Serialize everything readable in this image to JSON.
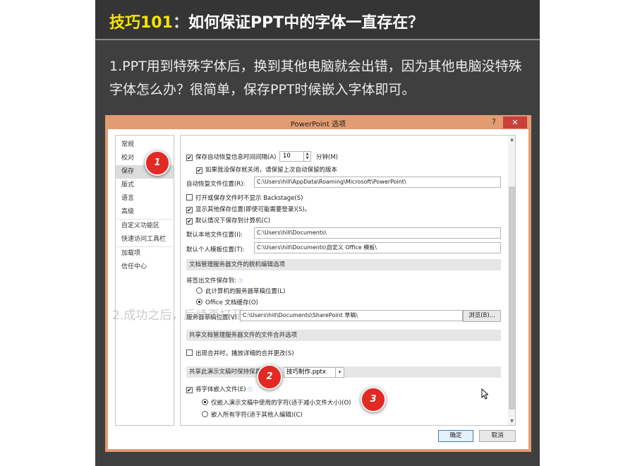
{
  "header": {
    "title_prefix": "技巧101",
    "title_text": "：如何保证PPT中的字体一直存在？"
  },
  "intro": "1.PPT用到特殊字体后，换到其他电脑就会出错，因为其他电脑没特殊字体怎么办？很简单，保存PPT时候嵌入字体即可。",
  "dialog": {
    "title": "PowerPoint 选项",
    "help": "?",
    "close": "✕",
    "nav": [
      "常规",
      "校对",
      "保存",
      "版式",
      "语言",
      "高级",
      "自定义功能区",
      "快速访问工具栏",
      "加载项",
      "信任中心"
    ],
    "content": {
      "autorecover_label": "保存自动恢复信息时间间隔(A)",
      "autorecover_minutes": "10",
      "minutes_unit": "分钟(M)",
      "keep_last_label": "如果我没保存就关闭，请保留上次自动保留的版本",
      "autorecover_location_label": "自动恢复文件位置(R):",
      "autorecover_location_value": "C:\\Users\\hill\\AppData\\Roaming\\Microsoft\\PowerPoint\\",
      "no_backstage_label": "打开或保存文件时不显示 Backstage(S)",
      "show_additional_label": "显示其他保存位置(即使可能需要登录)(S)。",
      "default_local_label": "默认情况下保存到计算机(C)",
      "default_local_location_label": "默认本地文件位置(I):",
      "default_local_location_value": "C:\\Users\\hill\\Documents\\",
      "personal_templates_label": "默认个人模板位置(T):",
      "personal_templates_value": "C:\\Users\\hill\\Documents\\自定义 Office 模板\\",
      "offline_section": "文档管理服务器文件的脱机编辑选项",
      "save_checked_out_label": "将签出文件保存到:",
      "server_drafts_label": "此计算机的服务器草稿位置(L)",
      "office_cache_label": "Office 文档缓存(O)",
      "server_drafts_location_label": "服务器草稿位置(V):",
      "server_drafts_location_value": "C:\\Users\\hill\\Documents\\SharePoint 草稿\\",
      "browse_button": "浏览(B)...",
      "merge_section": "共享文档管理服务器文件的文件合并选项",
      "show_merge_label": "出现合并时，播放详细的合并更改(S)",
      "fidelity_section": "共享此演示文稿时保持保真度(D):",
      "file_dropdown": "技巧制作.pptx",
      "embed_fonts_label": "将字体嵌入文件(E)",
      "embed_used_label": "仅嵌入演示文稿中使用的字符(适于减小文件大小)(O)",
      "embed_all_label": "嵌入所有字符(适于其他人编辑)(C)"
    },
    "ok_button": "确定",
    "cancel_button": "取消"
  },
  "annotations": [
    "1",
    "2",
    "3"
  ],
  "watermark": "2.成功之后，后续再打开",
  "colors": {
    "title_accent": "#f5e600",
    "panel_bg": "#3f3f3f",
    "dialog_border": "#e39b72",
    "badge_red": "#e02a23"
  }
}
